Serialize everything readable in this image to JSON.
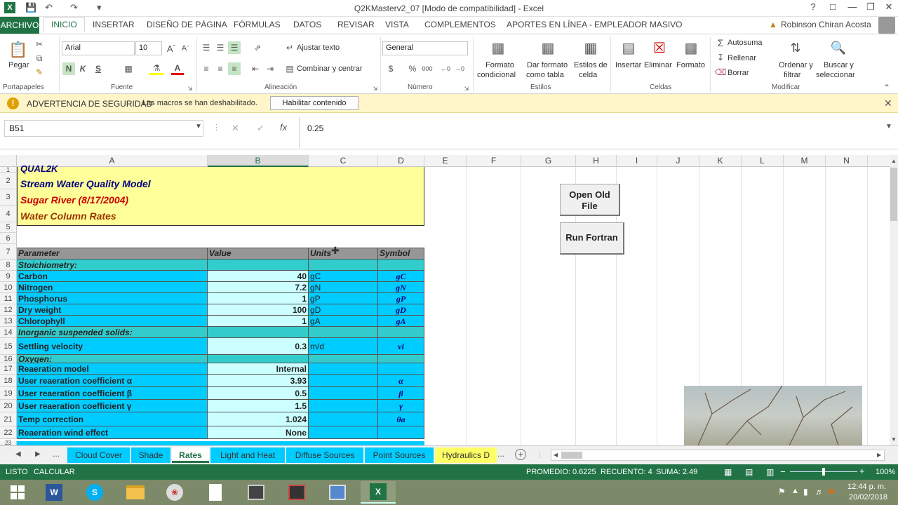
{
  "window": {
    "title": "Q2KMasterv2_07  [Modo de compatibilidad] - Excel",
    "user": "Robinson Chiran Acosta"
  },
  "ribbon_tabs": [
    "ARCHIVO",
    "INICIO",
    "INSERTAR",
    "DISEÑO DE PÁGINA",
    "FÓRMULAS",
    "DATOS",
    "REVISAR",
    "VISTA",
    "COMPLEMENTOS",
    "APORTES EN LÍNEA - EMPLEADOR MASIVO"
  ],
  "ribbon": {
    "paste": "Pegar",
    "font_name": "Arial",
    "font_size": "10",
    "bold": "N",
    "italic": "K",
    "underline": "S",
    "wrap_text": "Ajustar texto",
    "merge_center": "Combinar y centrar",
    "number_format": "General",
    "cond_format": [
      "Formato",
      "condicional"
    ],
    "table_format": [
      "Dar formato",
      "como tabla"
    ],
    "cell_styles": [
      "Estilos de",
      "celda"
    ],
    "insert": "Insertar",
    "delete": "Eliminar",
    "format": "Formato",
    "autosum": "Autosuma",
    "fill": "Rellenar",
    "clear": "Borrar",
    "sort": [
      "Ordenar y",
      "filtrar"
    ],
    "find": [
      "Buscar y",
      "seleccionar"
    ],
    "groups": [
      "Portapapeles",
      "Fuente",
      "Alineación",
      "Número",
      "Estilos",
      "Celdas",
      "Modificar"
    ]
  },
  "security": {
    "title": "ADVERTENCIA DE SEGURIDAD",
    "message": "Las macros se han deshabilitado.",
    "button": "Habilitar contenido"
  },
  "formula_bar": {
    "name_box": "B51",
    "formula": "0.25"
  },
  "columns": [
    "A",
    "B",
    "C",
    "D",
    "E",
    "F",
    "G",
    "H",
    "I",
    "J",
    "K",
    "L",
    "M",
    "N"
  ],
  "header_block": [
    "QUAL2K",
    "Stream Water Quality Model",
    "Sugar River (8/17/2004)",
    "Water Column Rates"
  ],
  "table_header": [
    "Parameter",
    "Value",
    "Units",
    "Symbol"
  ],
  "rows": [
    {
      "n": "8",
      "param": "Stoichiometry:",
      "value": "",
      "units": "",
      "symbol": "",
      "section": true
    },
    {
      "n": "9",
      "param": "Carbon",
      "value": "40",
      "units": "gC",
      "symbol": "gC"
    },
    {
      "n": "10",
      "param": "Nitrogen",
      "value": "7.2",
      "units": "gN",
      "symbol": "gN"
    },
    {
      "n": "11",
      "param": "Phosphorus",
      "value": "1",
      "units": "gP",
      "symbol": "gP"
    },
    {
      "n": "12",
      "param": "Dry weight",
      "value": "100",
      "units": "gD",
      "symbol": "gD"
    },
    {
      "n": "13",
      "param": "Chlorophyll",
      "value": "1",
      "units": "gA",
      "symbol": "gA"
    },
    {
      "n": "14",
      "param": "Inorganic suspended solids:",
      "value": "",
      "units": "",
      "symbol": "",
      "section": true
    },
    {
      "n": "15",
      "param": "Settling velocity",
      "value": "0.3",
      "units": "m/d",
      "symbol": "vi"
    },
    {
      "n": "16",
      "param": "Oxygen:",
      "value": "",
      "units": "",
      "symbol": "",
      "section": true
    },
    {
      "n": "17",
      "param": "Reaeration model",
      "value": "Internal",
      "units": "",
      "symbol": ""
    },
    {
      "n": "18",
      "param": "User reaeration coefficient α",
      "value": "3.93",
      "units": "",
      "symbol": "α"
    },
    {
      "n": "19",
      "param": "User reaeration coefficient β",
      "value": "0.5",
      "units": "",
      "symbol": "β"
    },
    {
      "n": "20",
      "param": "User reaeration coefficient γ",
      "value": "1.5",
      "units": "",
      "symbol": "γ"
    },
    {
      "n": "21",
      "param": "Temp correction",
      "value": "1.024",
      "units": "",
      "symbol": "θa"
    },
    {
      "n": "22",
      "param": "Reaeration wind effect",
      "value": "None",
      "units": "",
      "symbol": ""
    }
  ],
  "buttons": {
    "open_old": "Open Old File",
    "run_fortran": "Run Fortran"
  },
  "sheet_tabs": [
    "Cloud Cover",
    "Shade",
    "Rates",
    "Light and Heat",
    "Diffuse Sources",
    "Point Sources",
    "Hydraulics D"
  ],
  "active_sheet": "Rates",
  "status": {
    "ready": "LISTO",
    "calc": "CALCULAR",
    "average": "PROMEDIO: 0.6225",
    "count": "RECUENTO: 4",
    "sum": "SUMA: 2.49",
    "zoom": "100%"
  },
  "clock": {
    "time": "12:44 p. m.",
    "date": "20/02/2018"
  },
  "colors": {
    "excel_green": "#217346",
    "header_yellow": "#ffff99",
    "table_cyan": "#00ccff",
    "section_teal": "#33cccc",
    "value_light": "#ccffff"
  }
}
